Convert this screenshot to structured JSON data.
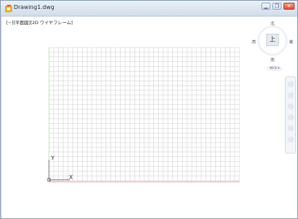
{
  "window": {
    "title": "Drawing1.dwg",
    "buttons": {
      "minimize_icon": "minimize-icon",
      "restore_icon": "restore-icon",
      "close_icon": "close-icon"
    }
  },
  "viewport": {
    "label": "[−][平面図][2D ワイヤフレーム]"
  },
  "viewcube": {
    "north": "北",
    "south": "南",
    "east": "東",
    "west": "西",
    "face": "上",
    "coord_system": "WCS"
  },
  "ucs_icon": {
    "y_label": "Y",
    "x_label": "X"
  },
  "colors": {
    "grid_line": "#c8c8c8",
    "grid_axis_y": "#7fc47f",
    "grid_axis_x": "#d48080",
    "title_bg": "#dfe7f2",
    "close_button": "#d64d30"
  }
}
